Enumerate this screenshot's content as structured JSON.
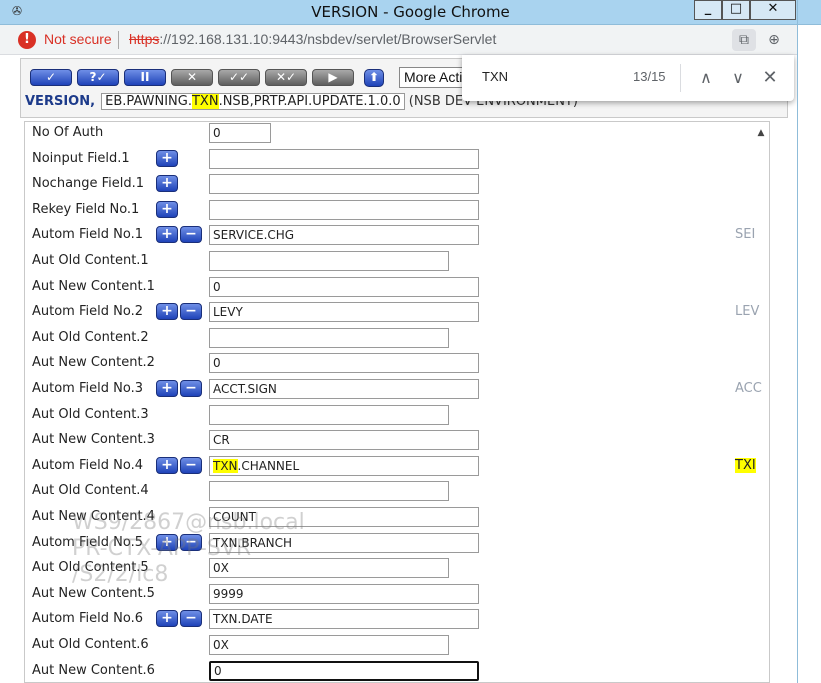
{
  "window": {
    "icon": "chrome-app-icon",
    "title": "VERSION - Google Chrome",
    "min_label": "_",
    "max_label": "□",
    "close_label": "✕"
  },
  "address": {
    "warn_glyph": "!",
    "not_secure": "Not secure",
    "scheme": "https",
    "rest": "://192.168.131.10:9443/nsbdev/servlet/BrowserServlet",
    "pip_icon": "⧉",
    "zoom_icon": "⊕"
  },
  "toolbar": {
    "buttons": [
      "✓",
      "?✓",
      "II",
      "✕",
      "✓✓",
      "✕✓",
      "▶"
    ],
    "up_glyph": "⬆",
    "more_actions": "More Actions"
  },
  "version": {
    "label": "VERSION,",
    "name_pre": "EB.PAWNING.",
    "name_hl": "TXN",
    "name_post": ".NSB,PRTP.API.UPDATE.1.0.0",
    "env": "(NSB DEV ENVIRONMENT)"
  },
  "find": {
    "query": "TXN",
    "count": "13/15",
    "prev_glyph": "∧",
    "next_glyph": "∨",
    "close_glyph": "✕"
  },
  "form": {
    "rows": [
      {
        "label": "No Of Auth",
        "value": "0"
      },
      {
        "label": "Noinput Field.1",
        "value": ""
      },
      {
        "label": "Nochange Field.1",
        "value": ""
      },
      {
        "label": "Rekey Field No.1",
        "value": ""
      },
      {
        "label": "Autom Field No.1",
        "value": "SERVICE.CHG",
        "aux": "SEI"
      },
      {
        "label": "Aut Old Content.1",
        "value": ""
      },
      {
        "label": "Aut New Content.1",
        "value": "0"
      },
      {
        "label": "Autom Field No.2",
        "value": "LEVY",
        "aux": "LEV"
      },
      {
        "label": "Aut Old Content.2",
        "value": ""
      },
      {
        "label": "Aut New Content.2",
        "value": "0"
      },
      {
        "label": "Autom Field No.3",
        "value": "ACCT.SIGN",
        "aux": "ACC"
      },
      {
        "label": "Aut Old Content.3",
        "value": ""
      },
      {
        "label": "Aut New Content.3",
        "value": "CR"
      },
      {
        "label": "Autom Field No.4",
        "value_hl": "TXN",
        "value_rest": ".CHANNEL",
        "aux": "TXI"
      },
      {
        "label": "Aut Old Content.4",
        "value": ""
      },
      {
        "label": "Aut New Content.4",
        "value": "COUNT"
      },
      {
        "label": "Autom Field No.5",
        "value": "TXN.BRANCH"
      },
      {
        "label": "Aut Old Content.5",
        "value": "0X"
      },
      {
        "label": "Aut New Content.5",
        "value": "9999"
      },
      {
        "label": "Autom Field No.6",
        "value": "TXN.DATE"
      },
      {
        "label": "Aut Old Content.6",
        "value": "0X"
      },
      {
        "label": "Aut New Content.6",
        "value": "0"
      }
    ],
    "plus_glyph": "+",
    "minus_glyph": "−",
    "scroll_up_glyph": "▲"
  },
  "watermark": {
    "line1": "WS9/2867@nsb.local",
    "line2": "PR-CTX-APP-SVR",
    "line3": "/S2/2/lc8"
  },
  "colors": {
    "titlebar": "#a9d3ef",
    "button_blue": "#1f43b8",
    "highlight": "#ffff00",
    "not_secure": "#d93025"
  }
}
